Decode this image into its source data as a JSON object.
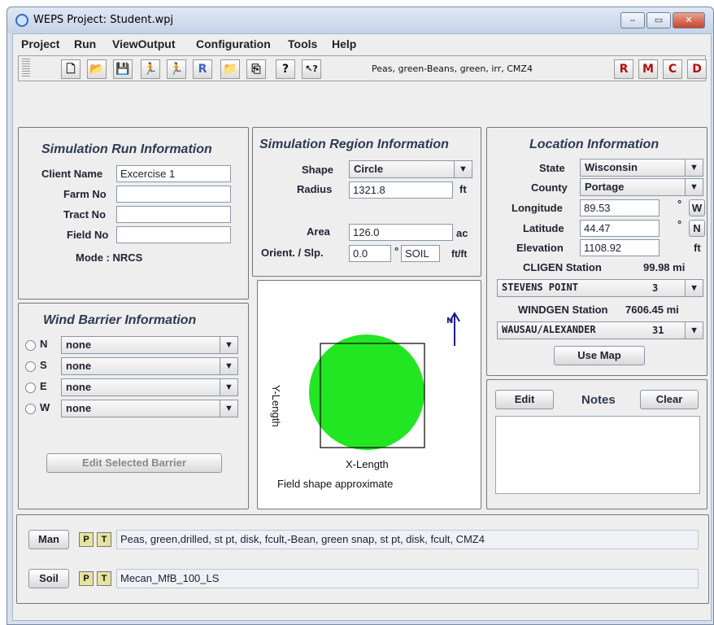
{
  "window": {
    "title": "WEPS Project: Student.wpj",
    "min": "‒",
    "max": "▭",
    "close": "✕"
  },
  "menu": [
    "Project",
    "Run",
    "ViewOutput",
    "Configuration",
    "Tools",
    "Help"
  ],
  "toolbar": {
    "icons": [
      "new-file",
      "open-folder",
      "save",
      "run",
      "run-batch",
      "run-r",
      "folder",
      "copy",
      "help",
      "context-help"
    ],
    "glyphs": [
      "🗋",
      "📂",
      "💾",
      "🏃",
      "🏃",
      "R",
      "📁",
      "⎘",
      "?",
      "↖?"
    ],
    "status_text": "Peas, green-Beans, green, irr, CMZ4",
    "right_glyphs": [
      "R",
      "M",
      "C",
      "D"
    ]
  },
  "sim_run": {
    "title": "Simulation Run Information",
    "client_label": "Client Name",
    "client_value": "Excercise 1",
    "farm_label": "Farm No",
    "farm_value": "",
    "tract_label": "Tract No",
    "tract_value": "",
    "field_label": "Field No",
    "field_value": "",
    "mode_label": "Mode : NRCS"
  },
  "region": {
    "title": "Simulation Region Information",
    "shape_label": "Shape",
    "shape_value": "Circle",
    "radius_label": "Radius",
    "radius_value": "1321.8",
    "radius_unit": "ft",
    "area_label": "Area",
    "area_value": "126.0",
    "area_unit": "ac",
    "orient_label": "Orient. / Slp.",
    "orient_value": "0.0",
    "deg": "°",
    "soil_label": "SOIL",
    "slope_unit": "ft/ft"
  },
  "location": {
    "title": "Location Information",
    "state_label": "State",
    "state_value": "Wisconsin",
    "county_label": "County",
    "county_value": "Portage",
    "lon_label": "Longitude",
    "lon_value": "89.53",
    "lon_dir": "W",
    "lat_label": "Latitude",
    "lat_value": "44.47",
    "lat_dir": "N",
    "deg": "°",
    "elev_label": "Elevation",
    "elev_value": "1108.92",
    "elev_unit": "ft",
    "cligen_label": "CLIGEN Station",
    "cligen_dist": "99.98 mi",
    "cligen_station": "STEVENS POINT",
    "cligen_num": "3",
    "windgen_label": "WINDGEN Station",
    "windgen_dist": "7606.45 mi",
    "windgen_station": "WAUSAU/ALEXANDER",
    "windgen_num": "31",
    "use_map": "Use Map"
  },
  "wind": {
    "title": "Wind Barrier Information",
    "rows": [
      {
        "dir": "N",
        "value": "none"
      },
      {
        "dir": "S",
        "value": "none"
      },
      {
        "dir": "E",
        "value": "none"
      },
      {
        "dir": "W",
        "value": "none"
      }
    ],
    "edit_button": "Edit Selected Barrier"
  },
  "field": {
    "y_label": "Y-Length",
    "x_label": "X-Length",
    "caption": "Field shape approximate",
    "north": "N",
    "fill_color": "#22e622"
  },
  "notes": {
    "edit": "Edit",
    "title": "Notes",
    "clear": "Clear",
    "text": ""
  },
  "man": {
    "button": "Man",
    "p": "P",
    "t": "T",
    "value": "Peas, green,drilled, st pt, disk, fcult,-Bean, green snap, st pt, disk, fcult, CMZ4"
  },
  "soil": {
    "button": "Soil",
    "p": "P",
    "t": "T",
    "value": "Mecan_MfB_100_LS"
  }
}
